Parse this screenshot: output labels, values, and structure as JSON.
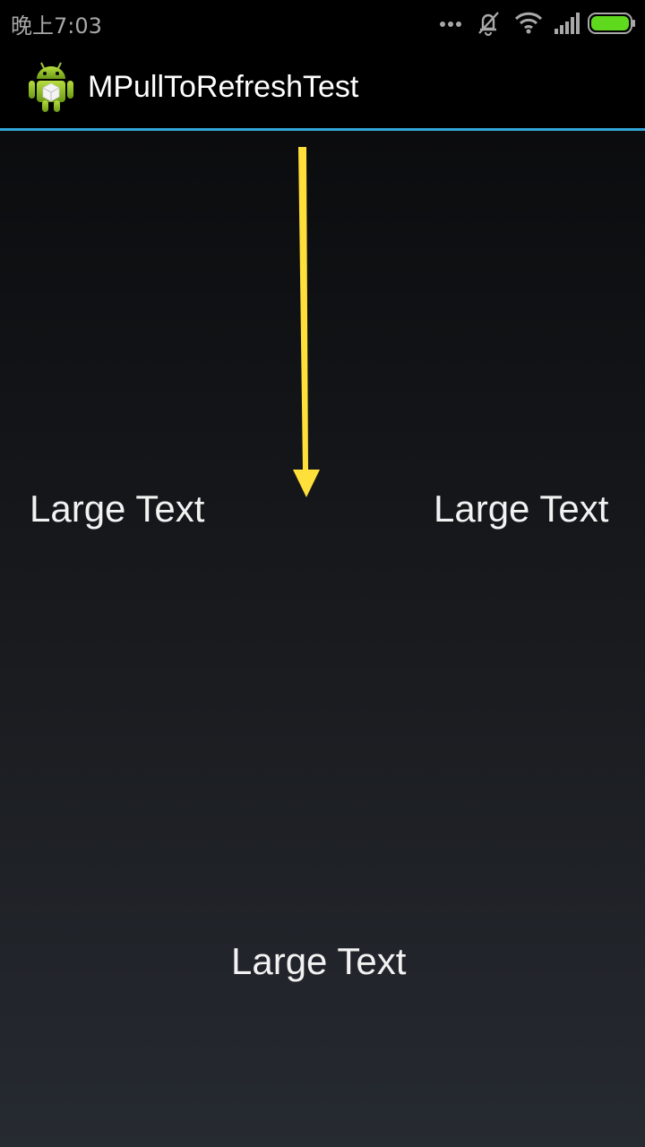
{
  "status_bar": {
    "time": "晚上7:03",
    "icons": [
      "more-dots-icon",
      "vibrate-off-icon",
      "wifi-icon",
      "signal-icon",
      "battery-icon"
    ],
    "battery_color": "#5fd91d"
  },
  "action_bar": {
    "title": "MPullToRefreshTest",
    "icon": "android-robot-icon",
    "divider_color": "#33a6d8"
  },
  "content": {
    "labels": [
      "Large Text",
      "Large Text",
      "Large Text"
    ],
    "arrow": {
      "icon": "down-arrow-icon",
      "color": "#ffdf3a"
    }
  }
}
